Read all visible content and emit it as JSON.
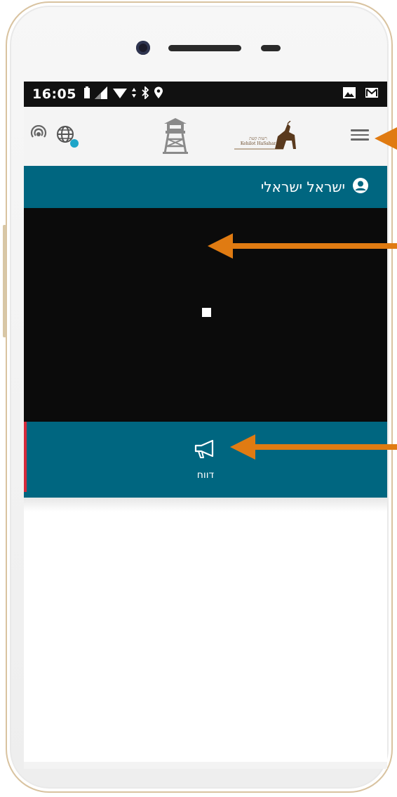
{
  "status_bar": {
    "time": "16:05",
    "left_icons": [
      "battery-icon",
      "signal-icon",
      "wifi-icon",
      "bluetooth-icon",
      "location-icon"
    ],
    "right_icons": [
      "gallery-icon",
      "gmail-icon"
    ]
  },
  "header": {
    "left_icons": [
      "broadcast-icon",
      "globe-icon"
    ],
    "center_icon": "watchtower-icon",
    "logo_text_hebrew": "רשות קשת",
    "logo_text_latin": "Kehilot HaSahar",
    "menu_icon": "hamburger-menu-icon"
  },
  "user_bar": {
    "name": "ישראל ישראלי",
    "icon": "user-circle-icon"
  },
  "bottom_bar": {
    "icon": "megaphone-icon",
    "label": "דווח"
  },
  "colors": {
    "teal": "#006680",
    "black": "#0b0b0b",
    "orange_arrow": "#e07b12",
    "accent_dot": "#1ea5c8",
    "red_edge": "#d62b3b"
  }
}
